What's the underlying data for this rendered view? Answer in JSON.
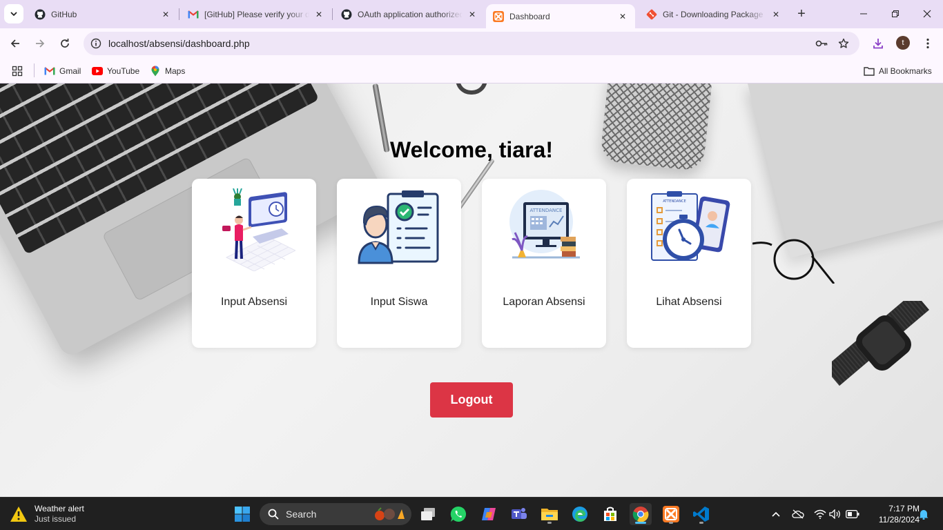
{
  "browser": {
    "tabs": [
      {
        "title": "GitHub",
        "icon": "github-icon",
        "active": false
      },
      {
        "title": "[GitHub] Please verify your device",
        "icon": "gmail-icon",
        "active": false
      },
      {
        "title": "OAuth application authorized",
        "icon": "github-icon",
        "active": false
      },
      {
        "title": "Dashboard",
        "icon": "xampp-icon",
        "active": true
      },
      {
        "title": "Git - Downloading Package",
        "icon": "git-icon",
        "active": false
      }
    ],
    "url_host": "localhost",
    "url_path": "/absensi/dashboard.php",
    "profile_initial": "t",
    "bookmarks": [
      {
        "label": "Gmail",
        "icon": "gmail-icon"
      },
      {
        "label": "YouTube",
        "icon": "youtube-icon"
      },
      {
        "label": "Maps",
        "icon": "maps-icon"
      }
    ],
    "all_bookmarks_label": "All Bookmarks"
  },
  "page": {
    "welcome": "Welcome, tiara!",
    "cards": [
      {
        "label": "Input Absensi",
        "illustration": "input-attendance-illustration"
      },
      {
        "label": "Input Siswa",
        "illustration": "student-checklist-illustration"
      },
      {
        "label": "Laporan Absensi",
        "illustration": "attendance-report-illustration"
      },
      {
        "label": "Lihat Absensi",
        "illustration": "attendance-clock-illustration"
      }
    ],
    "logout_label": "Logout",
    "colors": {
      "logout": "#dc3545",
      "card": "#ffffff"
    }
  },
  "taskbar": {
    "weather_title": "Weather alert",
    "weather_subtitle": "Just issued",
    "search_placeholder": "Search",
    "time": "7:17 PM",
    "date": "11/28/2024"
  }
}
